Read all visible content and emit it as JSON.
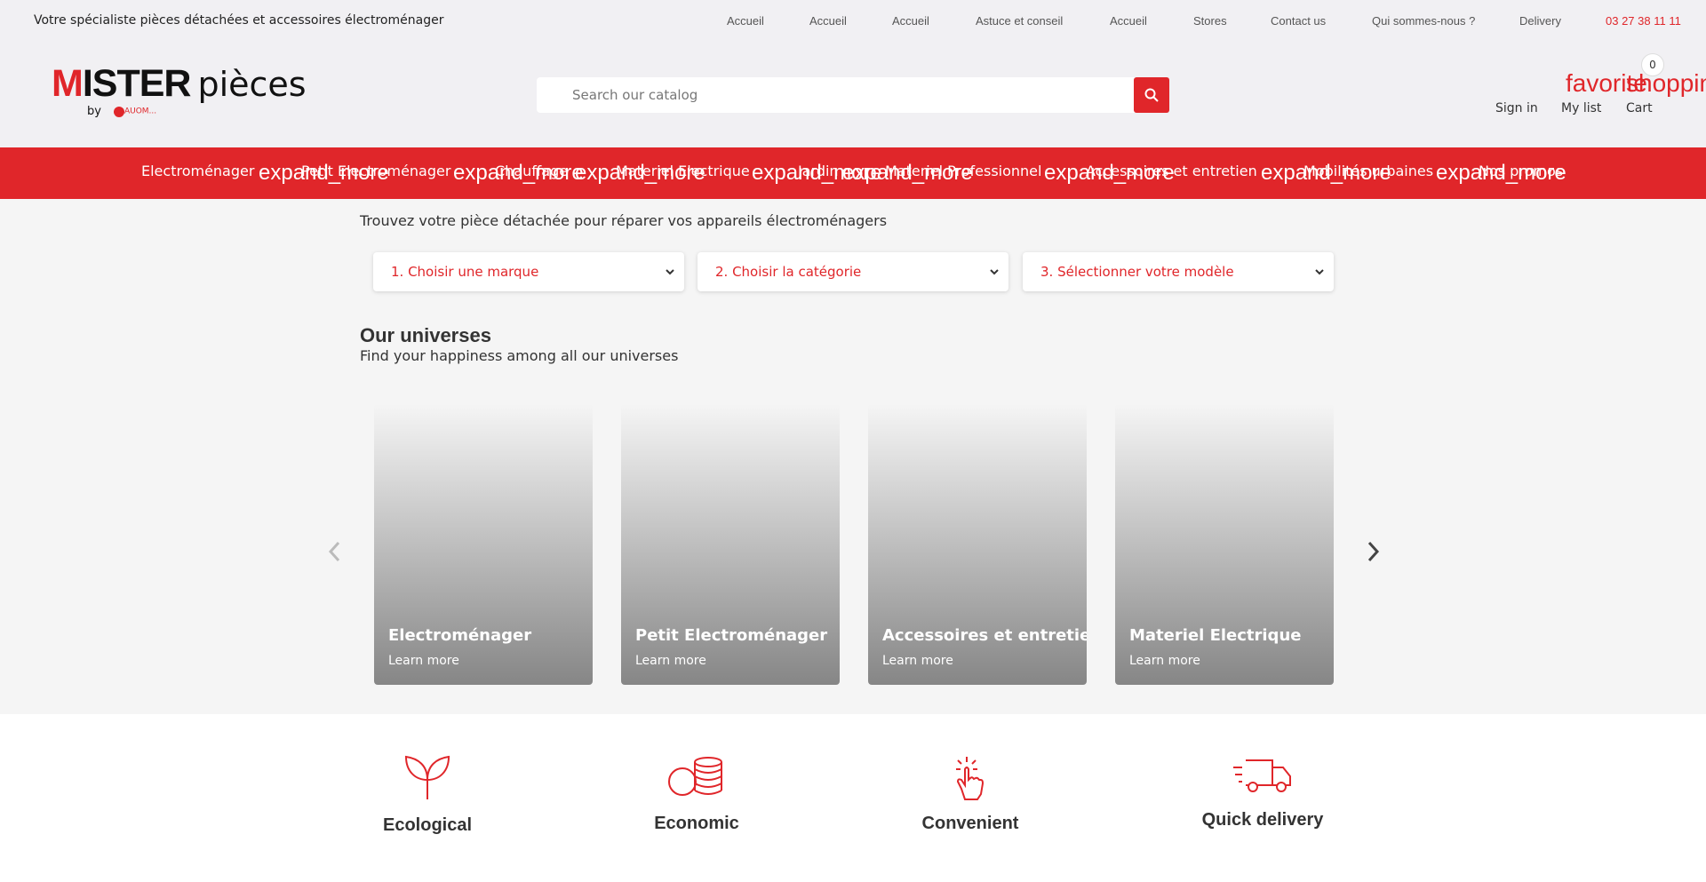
{
  "colors": {
    "accent": "#e0262a",
    "background": "#f5f5f5",
    "topbar": "#f1f0f3"
  },
  "topbar": {
    "tagline": "Votre spécialiste pièces détachées et accessoires électroménager",
    "nav": [
      "Accueil",
      "Accueil",
      "Accueil",
      "Astuce et conseil",
      "Accueil",
      "Stores",
      "Contact us",
      "Qui sommes-nous ?",
      "Delivery"
    ],
    "phone": "03 27 38 11 11"
  },
  "logo": {
    "brand_first": "M",
    "brand_rest": "ISTER",
    "suffix": "pièces",
    "by": "by",
    "partner": "AUOM..."
  },
  "search": {
    "placeholder": "Search our catalog",
    "icon": "search-icon"
  },
  "header_actions": {
    "signin_icon": "",
    "signin_label": "Sign in",
    "list_icon": "favorite",
    "list_label": "My list",
    "cart_icon": "shopping",
    "cart_label": "Cart",
    "cart_count": "0"
  },
  "categories": [
    {
      "label": "Electroménager",
      "icon": "expand_more"
    },
    {
      "label": "Petit Electroménager",
      "icon": "expand_more"
    },
    {
      "label": "Chauffage",
      "icon": "expand_more"
    },
    {
      "label": "Materiel Electrique",
      "icon": "expand_more"
    },
    {
      "label": "Jardin",
      "icon": "expand_more"
    },
    {
      "label": "Materiel Professionnel",
      "icon": "expand_more"
    },
    {
      "label": "Accessoires et entretien",
      "icon": "expand_more"
    },
    {
      "label": "Mobilités urbaines",
      "icon": "expand_more"
    },
    {
      "label": "Nos promos",
      "icon": ""
    }
  ],
  "finder": {
    "title": "Trouvez votre pièce détachée pour réparer vos appareils électroménagers",
    "selects": [
      "1. Choisir une marque",
      "2. Choisir la catégorie",
      "3. Sélectionner votre modèle"
    ]
  },
  "universes": {
    "title": "Our universes",
    "subtitle": "Find your happiness among all our universes",
    "cards": [
      {
        "title": "Electroménager",
        "link": "Learn more"
      },
      {
        "title": "Petit Electroménager",
        "link": "Learn more"
      },
      {
        "title": "Accessoires et entretien",
        "link": "Learn more"
      },
      {
        "title": "Materiel Electrique",
        "link": "Learn more"
      }
    ]
  },
  "features": [
    {
      "label": "Ecological",
      "icon": "sprout-icon"
    },
    {
      "label": "Economic",
      "icon": "coins-icon"
    },
    {
      "label": "Convenient",
      "icon": "tap-hand-icon"
    },
    {
      "label": "Quick delivery",
      "icon": "delivery-truck-icon"
    }
  ]
}
